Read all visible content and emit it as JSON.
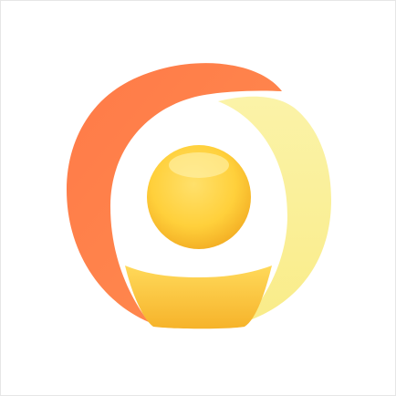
{
  "logo": {
    "icon": "app-logo-person-in-circle-icon",
    "colors": {
      "background": "#ffffff",
      "left_arc": "#ff7f49",
      "right_arc": "#f9ef93",
      "head_light": "#ffd54a",
      "head_dark": "#f6b426",
      "body_light": "#ffd95a",
      "body_dark": "#f6b32a"
    }
  }
}
